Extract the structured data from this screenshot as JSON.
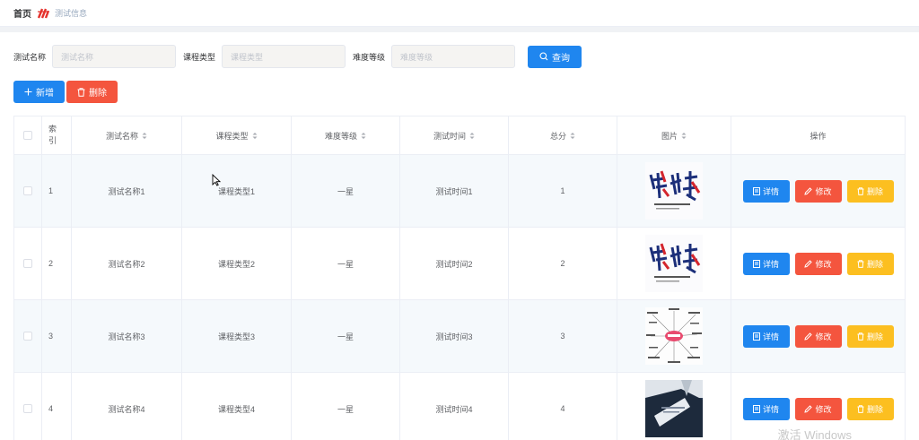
{
  "breadcrumb": {
    "home": "首页",
    "current": "测试信息"
  },
  "search": {
    "name_label": "测试名称",
    "name_placeholder": "测试名称",
    "type_label": "课程类型",
    "type_placeholder": "课程类型",
    "level_label": "难度等级",
    "level_placeholder": "难度等级",
    "search_button": "查询"
  },
  "actions": {
    "add": "新增",
    "delete": "删除"
  },
  "table": {
    "headers": {
      "index": [
        "索",
        "引"
      ],
      "name": "测试名称",
      "type": "课程类型",
      "difficulty": "难度等级",
      "time": "测试时间",
      "score": "总分",
      "image": "图片",
      "ops": "操作"
    },
    "rows": [
      {
        "index": "1",
        "name": "测试名称1",
        "type": "课程类型1",
        "difficulty": "一星",
        "time": "测试时间1",
        "score": "1",
        "image": "jianshen-poster"
      },
      {
        "index": "2",
        "name": "测试名称2",
        "type": "课程类型2",
        "difficulty": "一星",
        "time": "测试时间2",
        "score": "2",
        "image": "jianshen-poster"
      },
      {
        "index": "3",
        "name": "测试名称3",
        "type": "课程类型3",
        "difficulty": "一星",
        "time": "测试时间3",
        "score": "3",
        "image": "have-mindmap"
      },
      {
        "index": "4",
        "name": "测试名称4",
        "type": "课程类型4",
        "difficulty": "一星",
        "time": "测试时间4",
        "score": "4",
        "image": "business-photo"
      }
    ],
    "op_labels": {
      "detail": "详情",
      "edit": "修改",
      "delete": "删除"
    }
  },
  "watermark": "激活 Windows",
  "colors": {
    "primary": "#1f86ef",
    "danger": "#f4553e",
    "warning": "#fcbf20"
  }
}
